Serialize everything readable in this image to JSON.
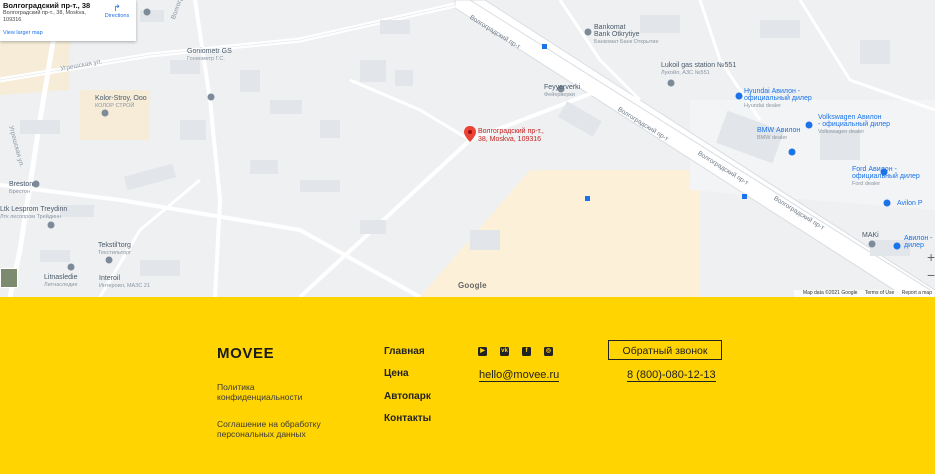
{
  "map": {
    "info_card": {
      "title": "Волгоградский пр-т., 38",
      "address_line1": "Волгоградский пр-т., 38, Moskva,",
      "address_line2": "109316",
      "larger_map_link": "View larger map",
      "directions_label": "Directions"
    },
    "pin_label_line1": "Волгоградский пр-т.,",
    "pin_label_line2": "38, Moskva, 109316",
    "streets": {
      "volgogradsky_upper": "Волгоградский пр-т",
      "volgogradsky_mid": "Волгоградский пр-т",
      "volgogradsky_lower1": "Волгоградский пр-т",
      "volgogradsky_lower2": "Волгоградский пр-т",
      "upper_left": "Угрешская ул.",
      "left_vertical": "Угрешская ул.",
      "top_vertical": "Волгоградская"
    },
    "pois": {
      "goniometr": "Goniometr GS",
      "goniometr_sub": "Гониометр Г.С.",
      "kolor": "Kolor-Stroy, Ooo",
      "kolor_sub": "КОЛОР СТРОЙ",
      "breston": "Breston",
      "breston_sub": "Брестон",
      "lesprom": "Ltk Lesprom Treydinn",
      "lesprom_sub": "Лтк лесопром Трейдинн",
      "tekstil": "Tekstil'torg",
      "tekstil_sub": "Текстильторг",
      "litnasledie": "Litnasledie",
      "litnasledie_sub": "Литнаследие",
      "interoil": "Interoil",
      "interoil_sub": "Интероил, МАЗС 21",
      "bankomat": "Bankomat",
      "bankomat_l2": "Bank Otkrytiye",
      "bankomat_sub": "Банкомат Банк Открытие",
      "feyyerverki": "Feyyerverki",
      "feyyerverki_sub": "Фейерверки",
      "lukoil": "Lukoil gas station №551",
      "lukoil_sub": "Лукойл, АЗС №551",
      "hyundai": "Hyundai Авилон -",
      "hyundai_l2": "официальный дилер",
      "hyundai_sub": "Hyundai dealer",
      "vw": "Volkswagen Авилон",
      "vw_l2": "- официальный дилер",
      "vw_sub": "Volkswagen dealer",
      "bmw": "BMW Авилон",
      "bmw_sub": "BMW dealer",
      "ford": "Ford Авилон -",
      "ford_l2": "официальный дилер",
      "ford_sub": "Ford dealer",
      "avilon": "Avilon P",
      "maki": "MAKi",
      "avilon2": "Авилон -",
      "avilon2_l2": "дилер"
    },
    "google_brand": "Google",
    "attribution": {
      "map_data": "Map data ©2021 Google",
      "terms": "Terms of Use",
      "report": "Report a map"
    },
    "zoom_in": "+",
    "zoom_out": "−"
  },
  "footer": {
    "logo": "MOVEE",
    "privacy_link": "Политика конфиденциальности",
    "consent_link": "Соглашение на обработку персональных данных",
    "nav": [
      "Главная",
      "Цена",
      "Автопарк",
      "Контакты"
    ],
    "socials": [
      "youtube-icon",
      "vk-icon",
      "facebook-icon",
      "instagram-icon"
    ],
    "email": "hello@movee.ru",
    "callback_button": "Обратный звонок",
    "phone": "8 (800)-080-12-13"
  },
  "colors": {
    "footer_bg": "#ffd400",
    "map_bg": "#eef0f2",
    "pin": "#ea4335",
    "link_blue": "#1a73e8"
  }
}
